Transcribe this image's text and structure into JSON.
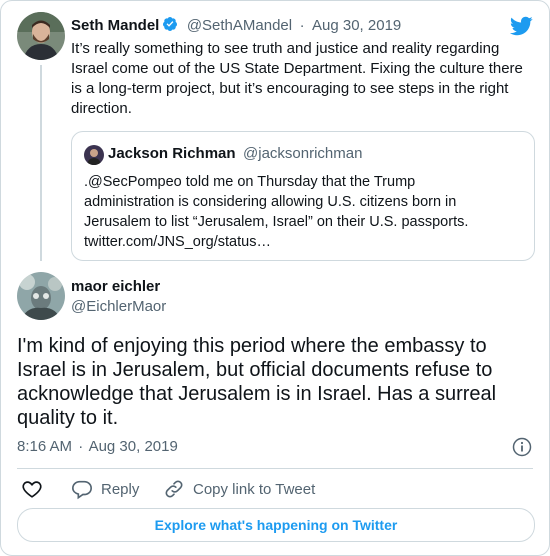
{
  "parent_tweet": {
    "name": "Seth Mandel",
    "handle": "@SethAMandel",
    "separator": "·",
    "date": "Aug 30, 2019",
    "text": "It’s really something to see truth and justice and reality regarding Israel come out of the US State Department. Fixing the culture there is a long-term project, but it’s encouraging to see steps in the right direction."
  },
  "quoted_tweet": {
    "name": "Jackson Richman",
    "handle": "@jacksonrichman",
    "text_lines": [
      ".@SecPompeo told me on Thursday that the Trump",
      "administration is considering allowing U.S. citizens born in",
      "Jerusalem to list “Jerusalem, Israel” on their U.S. passports.",
      "twitter.com/JNS_org/status…"
    ]
  },
  "main_tweet": {
    "name": "maor eichler",
    "handle": "@EichlerMaor",
    "text": "I'm kind of enjoying this period where the embassy to Israel is in Jerusalem, but official documents refuse to acknowledge that Jerusalem is in Israel. Has a surreal quality to it.",
    "time": "8:16 AM",
    "separator": "·",
    "date": "Aug 30, 2019"
  },
  "actions": {
    "reply_label": "Reply",
    "copy_label": "Copy link to Tweet"
  },
  "explore_label": "Explore what's happening on Twitter",
  "icons": {
    "logo": "twitter-bird-icon",
    "verified": "verified-badge-icon",
    "info": "info-icon",
    "like": "heart-icon",
    "reply": "reply-bubble-icon",
    "copy": "link-icon"
  },
  "colors": {
    "brand": "#1d9bf0",
    "like": "#0f1419",
    "muted": "#536471",
    "border": "#cfd9de"
  }
}
